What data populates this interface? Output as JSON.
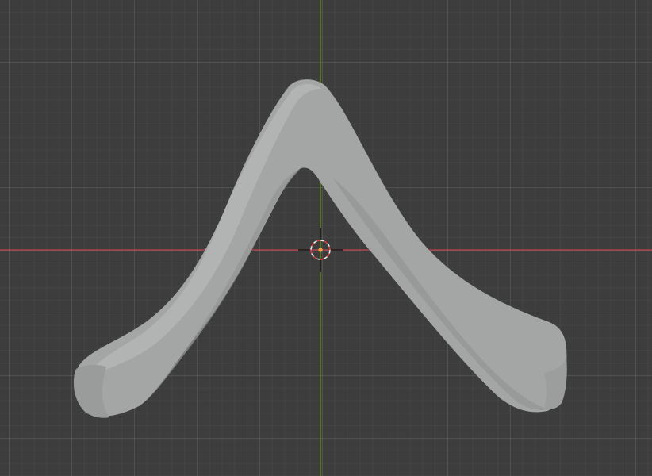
{
  "viewport": {
    "view": "front-orthographic",
    "background_color": "#3d3d3d",
    "grid_color": "#4a4a4a"
  },
  "axes": {
    "x_axis_color": "#c2434d",
    "z_axis_color": "#6c9d1f"
  },
  "object": {
    "shape": "caret-arch",
    "color": "#a4a6a5",
    "shadow_color": "#8a8c8b",
    "highlight_color": "#b6b8b7"
  },
  "cursor_3d": {
    "icon": "3d-cursor-icon",
    "ring_color": "#e8e8e8",
    "accent_color": "#d63c3c",
    "center_color": "#f0a040"
  }
}
